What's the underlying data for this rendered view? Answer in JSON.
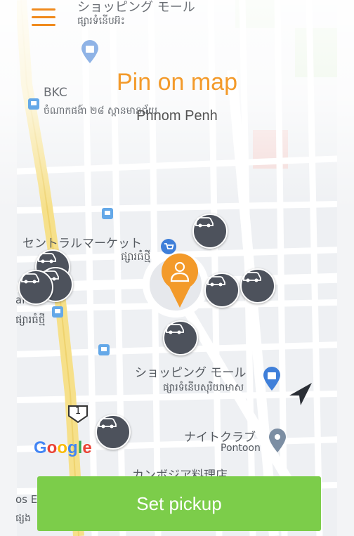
{
  "header": {
    "menu_icon": "hamburger-icon",
    "title": "Pin on map",
    "subtitle": "Phnom Penh"
  },
  "map": {
    "labels": {
      "top_jp": "ショッピング モール",
      "top_khmer": "ផ្សារទំនើបអ៊ះ",
      "bkc": "BKC",
      "bkc_khmer": "ចំណាកផង៍ា ២៨ ស្ពានមានជ័យ",
      "central_market_jp": "セントラルマーケット",
      "central_market_khmer": "ផ្សារធំថ្មី",
      "left_khmer": "ផ្សារធំថ្មី",
      "left_partial": "ai",
      "mall_jp": "ショッピング モール",
      "mall_khmer": "ផ្សារទំនើបសុរិយាមាស",
      "nightclub_jp": "ナイトクラブ",
      "pontoon": "Pontoon",
      "cambodian_restaurant_jp": "カンボジア料理店",
      "bottom_left_partial": "os E",
      "bottom_left_khmer": "ផ្សង",
      "route_shield": "1",
      "google": "Google"
    },
    "colors": {
      "accent": "#f39a2a",
      "car_marker": "#4d525c",
      "main_road": "#f6e08a",
      "button": "#7ccd4a"
    }
  },
  "markers": {
    "pickup_pin_icon": "person-pin-icon",
    "car_icon": "car-icon",
    "navigation_icon": "navigation-arrow-icon"
  },
  "action": {
    "set_pickup_label": "Set pickup"
  }
}
